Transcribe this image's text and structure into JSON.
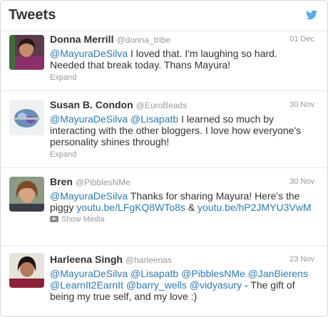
{
  "header": {
    "title": "Tweets",
    "logo_icon": "twitter-bird-icon",
    "logo_color": "#55acee"
  },
  "colors": {
    "link": "#2b7bb9",
    "muted": "#999999",
    "text": "#333333"
  },
  "tweets": [
    {
      "name": "Donna Merrill",
      "handle": "@donna_tribe",
      "date": "01 Dec",
      "parts": [
        {
          "t": "mention",
          "v": "@MayuraDeSilva"
        },
        {
          "t": "text",
          "v": " I loved that. I'm laughing so hard. Needed that break today. Thans Mayura!"
        }
      ],
      "action": "Expand"
    },
    {
      "name": "Susan B. Condon",
      "handle": "@EuroBeads",
      "date": "30 Nov",
      "parts": [
        {
          "t": "mention",
          "v": "@MayuraDeSilva"
        },
        {
          "t": "text",
          "v": " "
        },
        {
          "t": "mention",
          "v": "@Lisapatb"
        },
        {
          "t": "text",
          "v": " I learned so much by interacting with the other bloggers. I love how everyone's personality shines through!"
        }
      ],
      "action": "Expand"
    },
    {
      "name": "Bren",
      "handle": "@PibblesNMe",
      "date": "30 Nov",
      "parts": [
        {
          "t": "mention",
          "v": "@MayuraDeSilva"
        },
        {
          "t": "text",
          "v": " Thanks for sharing Mayura! Here's the piggy "
        },
        {
          "t": "link",
          "v": "youtu.be/LFgKQ8WTo8s"
        },
        {
          "t": "text",
          "v": " & "
        },
        {
          "t": "link",
          "v": "youtu.be/hP2JMYU3VwM"
        }
      ],
      "action": "Show Media"
    },
    {
      "name": "Harleena Singh",
      "handle": "@harleenas",
      "date": "23 Nov",
      "parts": [
        {
          "t": "mention",
          "v": "@MayuraDeSilva"
        },
        {
          "t": "text",
          "v": " "
        },
        {
          "t": "mention",
          "v": "@Lisapatb"
        },
        {
          "t": "text",
          "v": " "
        },
        {
          "t": "mention",
          "v": "@PibblesNMe"
        },
        {
          "t": "text",
          "v": " "
        },
        {
          "t": "mention",
          "v": "@JanBierens"
        },
        {
          "t": "text",
          "v": " "
        },
        {
          "t": "mention",
          "v": "@LearnIt2EarnIt"
        },
        {
          "t": "text",
          "v": " "
        },
        {
          "t": "mention",
          "v": "@barry_wells"
        },
        {
          "t": "text",
          "v": " "
        },
        {
          "t": "mention",
          "v": "@vidyasury"
        },
        {
          "t": "text",
          "v": " - The gift of being my true self, and my love :)"
        }
      ],
      "action": ""
    }
  ]
}
